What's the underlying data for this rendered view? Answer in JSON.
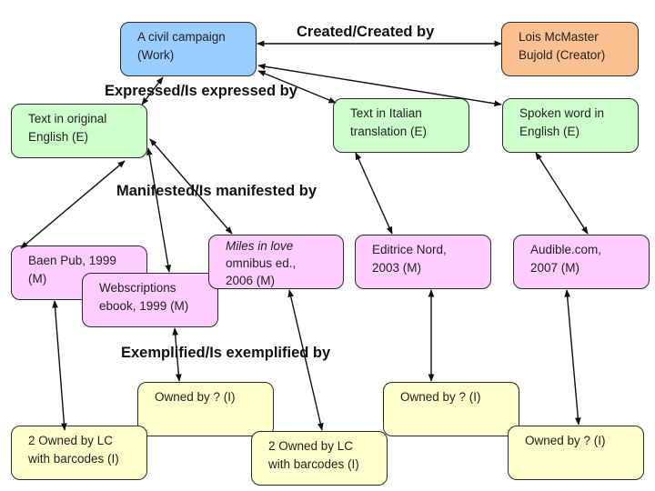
{
  "colors": {
    "work": "#99ccff",
    "creator": "#fac090",
    "expression": "#ccffcc",
    "manifestation": "#ffccff",
    "item": "#ffffcc"
  },
  "work": {
    "line1": "A civil campaign",
    "line2": "(Work)"
  },
  "creator": {
    "line1": "Lois McMaster",
    "line2": "Bujold (Creator)"
  },
  "relations": {
    "created": "Created/Created by",
    "expressed": "Expressed/Is expressed by",
    "manifested": "Manifested/Is manifested by",
    "exemplified": "Exemplified/Is exemplified by"
  },
  "expressions": [
    {
      "line1": "Text in original",
      "line2": "English (E)"
    },
    {
      "line1": "Text in Italian",
      "line2": "translation (E)"
    },
    {
      "line1": "Spoken word in",
      "line2": "English (E)"
    }
  ],
  "manifestations": [
    {
      "line1": "Baen Pub, 1999",
      "line2": "(M)"
    },
    {
      "line1": "Webscriptions",
      "line2": "ebook, 1999 (M)"
    },
    {
      "line1": "Miles in love",
      "line2": "omnibus ed.,",
      "line3": "2006 (M)"
    },
    {
      "line1": "Editrice Nord,",
      "line2": "2003 (M)"
    },
    {
      "line1": "Audible.com,",
      "line2": "2007 (M)"
    }
  ],
  "items": [
    {
      "line1": "Owned by ? (I)"
    },
    {
      "line1": "2 Owned by LC",
      "line2": "with barcodes (I)"
    },
    {
      "line1": "Owned by ? (I)"
    },
    {
      "line1": "2 Owned by LC",
      "line2": "with barcodes (I)"
    },
    {
      "line1": "Owned by ? (I)"
    }
  ]
}
